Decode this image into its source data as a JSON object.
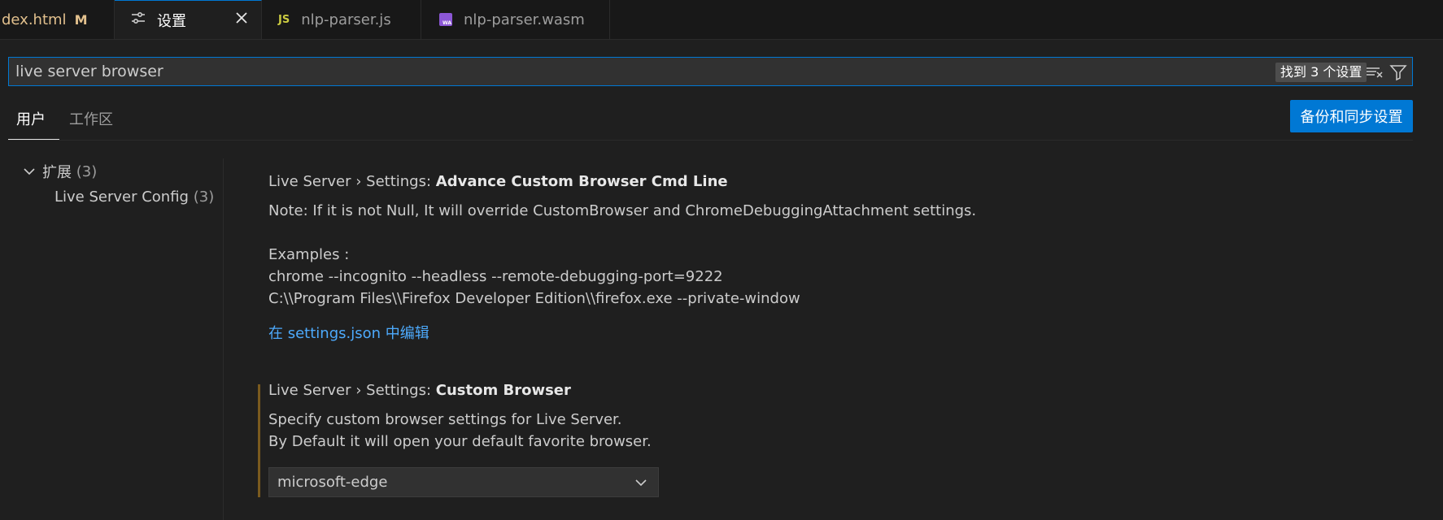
{
  "tabs": [
    {
      "label_prefix": "dex.html",
      "badge": "M"
    },
    {
      "label": "设置",
      "icon": "settings-sliders-icon",
      "close": "close-icon"
    },
    {
      "label": "nlp-parser.js",
      "icon": "js-file-icon",
      "icon_text": "JS"
    },
    {
      "label": "nlp-parser.wasm",
      "icon": "wasm-file-icon"
    }
  ],
  "search": {
    "value": "live server browser",
    "result_count": "找到 3 个设置",
    "clear_icon": "clear-filter-icon",
    "filter_icon": "filter-icon"
  },
  "scopes": {
    "user": "用户",
    "workspace": "工作区"
  },
  "backup_button": "备份和同步设置",
  "toc": {
    "extensions": {
      "label": "扩展",
      "count": "(3)"
    },
    "live_server": {
      "label": "Live Server Config",
      "count": "(3)"
    }
  },
  "settings": [
    {
      "prefix": "Live Server › Settings: ",
      "name": "Advance Custom Browser Cmd Line",
      "description": [
        "Note: If it is not Null, It will override CustomBrowser and ChromeDebuggingAttachment settings.",
        "Examples :",
        "chrome --incognito --headless --remote-debugging-port=9222",
        "C:\\\\Program Files\\\\Firefox Developer Edition\\\\firefox.exe --private-window"
      ],
      "link": "在 settings.json 中编辑"
    },
    {
      "prefix": "Live Server › Settings: ",
      "name": "Custom Browser",
      "description": [
        "Specify custom browser settings for Live Server.",
        "By Default it will open your default favorite browser."
      ],
      "selected": "microsoft-edge"
    }
  ],
  "colors": {
    "accent": "#0078d4",
    "link": "#4daafc",
    "modified": "#e2c08d",
    "background": "#1f1f1f"
  }
}
